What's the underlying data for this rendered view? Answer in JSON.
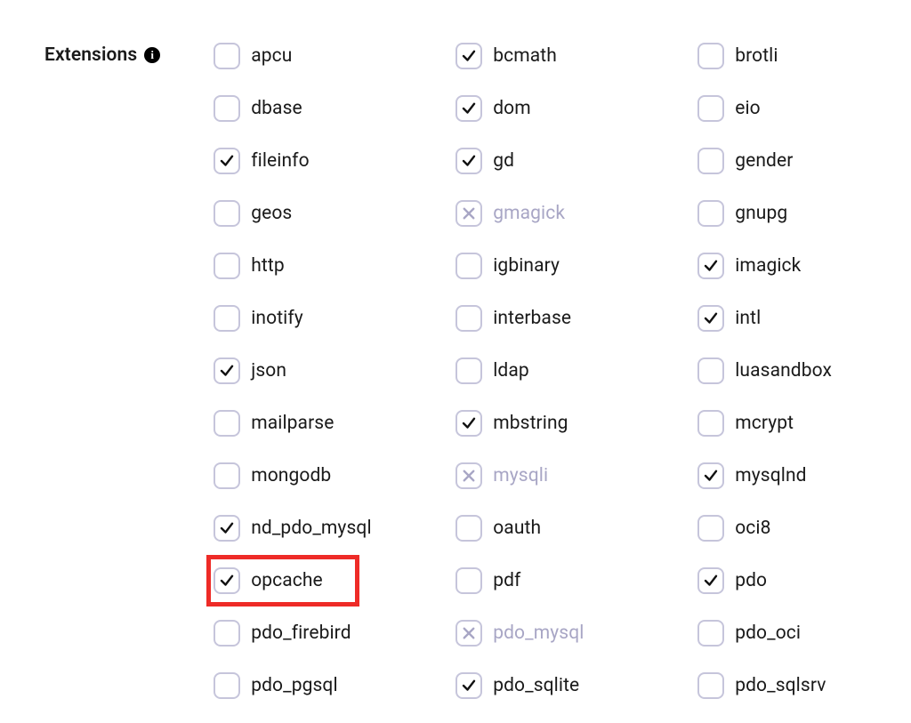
{
  "section_label": "Extensions",
  "info_glyph": "i",
  "extensions": {
    "col1": [
      {
        "name": "apcu",
        "state": "unchecked"
      },
      {
        "name": "dbase",
        "state": "unchecked"
      },
      {
        "name": "fileinfo",
        "state": "checked"
      },
      {
        "name": "geos",
        "state": "unchecked"
      },
      {
        "name": "http",
        "state": "unchecked"
      },
      {
        "name": "inotify",
        "state": "unchecked"
      },
      {
        "name": "json",
        "state": "checked"
      },
      {
        "name": "mailparse",
        "state": "unchecked"
      },
      {
        "name": "mongodb",
        "state": "unchecked"
      },
      {
        "name": "nd_pdo_mysql",
        "state": "checked"
      },
      {
        "name": "opcache",
        "state": "checked",
        "highlight": true
      },
      {
        "name": "pdo_firebird",
        "state": "unchecked"
      },
      {
        "name": "pdo_pgsql",
        "state": "unchecked"
      }
    ],
    "col2": [
      {
        "name": "bcmath",
        "state": "checked"
      },
      {
        "name": "dom",
        "state": "checked"
      },
      {
        "name": "gd",
        "state": "checked"
      },
      {
        "name": "gmagick",
        "state": "disabled"
      },
      {
        "name": "igbinary",
        "state": "unchecked"
      },
      {
        "name": "interbase",
        "state": "unchecked"
      },
      {
        "name": "ldap",
        "state": "unchecked"
      },
      {
        "name": "mbstring",
        "state": "checked"
      },
      {
        "name": "mysqli",
        "state": "disabled"
      },
      {
        "name": "oauth",
        "state": "unchecked"
      },
      {
        "name": "pdf",
        "state": "unchecked"
      },
      {
        "name": "pdo_mysql",
        "state": "disabled"
      },
      {
        "name": "pdo_sqlite",
        "state": "checked"
      }
    ],
    "col3": [
      {
        "name": "brotli",
        "state": "unchecked"
      },
      {
        "name": "eio",
        "state": "unchecked"
      },
      {
        "name": "gender",
        "state": "unchecked"
      },
      {
        "name": "gnupg",
        "state": "unchecked"
      },
      {
        "name": "imagick",
        "state": "checked"
      },
      {
        "name": "intl",
        "state": "checked"
      },
      {
        "name": "luasandbox",
        "state": "unchecked"
      },
      {
        "name": "mcrypt",
        "state": "unchecked"
      },
      {
        "name": "mysqlnd",
        "state": "checked"
      },
      {
        "name": "oci8",
        "state": "unchecked"
      },
      {
        "name": "pdo",
        "state": "checked"
      },
      {
        "name": "pdo_oci",
        "state": "unchecked"
      },
      {
        "name": "pdo_sqlsrv",
        "state": "unchecked"
      }
    ]
  }
}
